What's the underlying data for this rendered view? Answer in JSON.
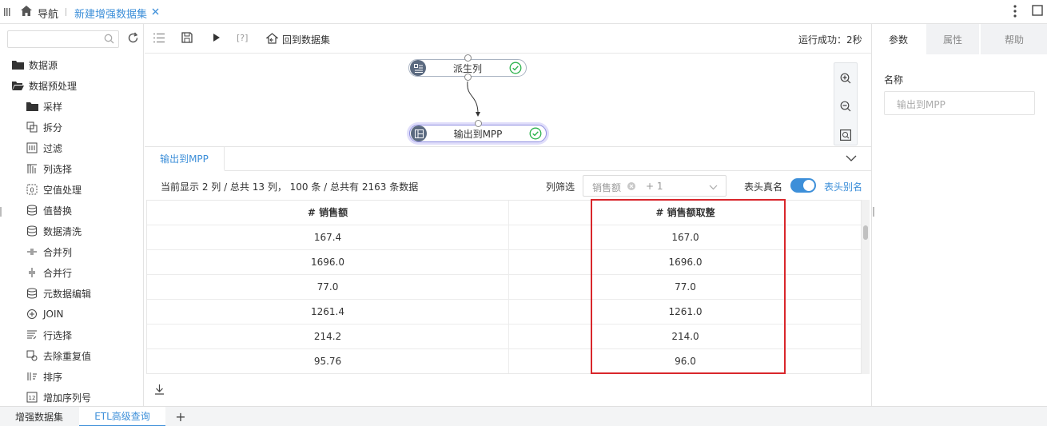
{
  "topbar": {
    "nav_label": "导航",
    "active_tab": "新建增强数据集"
  },
  "sidebar": {
    "search_placeholder": "",
    "items": [
      {
        "label": "数据源",
        "icon": "folder-icon"
      },
      {
        "label": "数据预处理",
        "icon": "folder-open-icon"
      },
      {
        "label": "采样",
        "icon": "folder-icon"
      },
      {
        "label": "拆分",
        "icon": "split-icon"
      },
      {
        "label": "过滤",
        "icon": "filter-icon"
      },
      {
        "label": "列选择",
        "icon": "column-select-icon"
      },
      {
        "label": "空值处理",
        "icon": "null-handle-icon"
      },
      {
        "label": "值替换",
        "icon": "database-icon"
      },
      {
        "label": "数据清洗",
        "icon": "database-icon"
      },
      {
        "label": "合并列",
        "icon": "merge-column-icon"
      },
      {
        "label": "合并行",
        "icon": "merge-row-icon"
      },
      {
        "label": "元数据编辑",
        "icon": "database-icon"
      },
      {
        "label": "JOIN",
        "icon": "join-icon"
      },
      {
        "label": "行选择",
        "icon": "row-select-icon"
      },
      {
        "label": "去除重复值",
        "icon": "dedupe-icon"
      },
      {
        "label": "排序",
        "icon": "sort-icon"
      },
      {
        "label": "增加序列号",
        "icon": "serial-number-icon"
      }
    ]
  },
  "toolbar": {
    "help_label": "[?]",
    "back_label": "回到数据集",
    "status": "运行成功：2秒"
  },
  "canvas": {
    "node1_label": "派生列",
    "node2_label": "输出到MPP"
  },
  "panel": {
    "tab_label": "输出到MPP",
    "info": "当前显示 2 列 / 总共 13 列， 100 条 / 总共有 2163 条数据",
    "filter_label": "列筛选",
    "filter_tag": "销售额",
    "filter_more": "+ 1",
    "header_real_label": "表头真名",
    "header_alias_label": "表头别名",
    "columns": [
      "# 销售额",
      "# 销售额取整"
    ],
    "rows": [
      [
        "167.4",
        "167.0"
      ],
      [
        "1696.0",
        "1696.0"
      ],
      [
        "77.0",
        "77.0"
      ],
      [
        "1261.4",
        "1261.0"
      ],
      [
        "214.2",
        "214.0"
      ],
      [
        "95.76",
        "96.0"
      ]
    ]
  },
  "right": {
    "tabs": [
      "参数",
      "属性",
      "帮助"
    ],
    "name_label": "名称",
    "name_value": "输出到MPP"
  },
  "bottom": {
    "tabs": [
      "增强数据集",
      "ETL高级查询"
    ],
    "add_label": "+"
  },
  "colors": {
    "accent": "#3d8fd9",
    "highlight": "#d9262b",
    "success": "#2bb24c"
  }
}
